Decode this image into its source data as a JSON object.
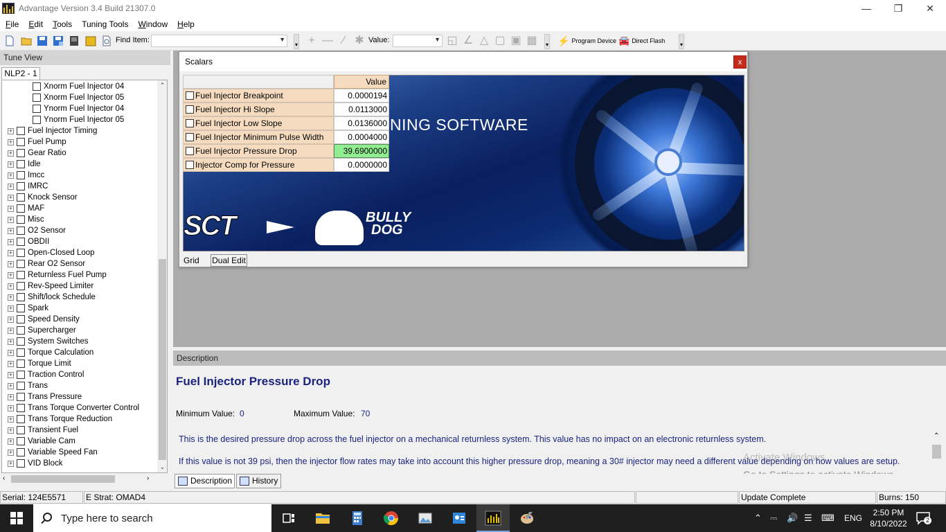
{
  "window": {
    "title": "Advantage Version 3.4 Build 21307.0"
  },
  "menu": [
    {
      "label": "File",
      "ul": "F",
      "rest": "ile"
    },
    {
      "label": "Edit",
      "ul": "E",
      "rest": "dit"
    },
    {
      "label": "Tools",
      "ul": "T",
      "rest": "ools"
    },
    {
      "label": "Tuning Tools",
      "ul": "Tu",
      "rest": "ning Tools"
    },
    {
      "label": "Window",
      "ul": "W",
      "rest": "indow"
    },
    {
      "label": "Help",
      "ul": "H",
      "rest": "elp"
    }
  ],
  "toolbar": {
    "find_label": "Find Item:",
    "find_value": "",
    "value_label": "Value:",
    "value_value": "",
    "program_device": "Program Device",
    "direct_flash": "Direct Flash"
  },
  "tune_view": {
    "header": "Tune View",
    "tab": "NLP2 - 1",
    "child_items": [
      "Xnorm Fuel Injector 04",
      "Xnorm Fuel Injector 05",
      "Ynorm Fuel Injector 04",
      "Ynorm Fuel Injector 05"
    ],
    "items": [
      "Fuel Injector Timing",
      "Fuel Pump",
      "Gear Ratio",
      "Idle",
      "Imcc",
      "IMRC",
      "Knock Sensor",
      "MAF",
      "Misc",
      "O2 Sensor",
      "OBDII",
      "Open-Closed Loop",
      "Rear O2 Sensor",
      "Returnless Fuel Pump",
      "Rev-Speed Limiter",
      "Shift/lock Schedule",
      "Spark",
      "Speed Density",
      "Supercharger",
      "System Switches",
      "Torque Calculation",
      "Torque Limit",
      "Traction Control",
      "Trans",
      "Trans Pressure",
      "Trans Torque Converter Control",
      "Trans Torque Reduction",
      "Transient Fuel",
      "Variable Cam",
      "Variable Speed Fan",
      "VID Block"
    ]
  },
  "scalars": {
    "title": "Scalars",
    "close": "x",
    "value_header": "Value",
    "rows": [
      {
        "name": "Fuel Injector Breakpoint",
        "value": "0.0000194"
      },
      {
        "name": "Fuel Injector Hi Slope",
        "value": "0.0113000"
      },
      {
        "name": "Fuel Injector Low Slope",
        "value": "0.0136000"
      },
      {
        "name": "Fuel Injector Minimum Pulse Width",
        "value": "0.0004000"
      },
      {
        "name": "Fuel Injector Pressure Drop",
        "value": "39.6900000"
      },
      {
        "name": "Injector Comp for Pressure",
        "value": "0.0000000"
      }
    ],
    "banner_text": "NING SOFTWARE",
    "banner_logo_sct": "SCT",
    "banner_logo_bully": "BULLY",
    "banner_logo_dog": "DOG",
    "tab_grid": "Grid",
    "tab_dual": "Dual Edit"
  },
  "description": {
    "header": "Description",
    "title": "Fuel Injector Pressure Drop",
    "min_label": "Minimum Value:",
    "min_value": "0",
    "max_label": "Maximum Value:",
    "max_value": "70",
    "para1": "This is the desired pressure drop across the fuel injector on a mechanical returnless system. This value has no impact on an electronic returnless system.",
    "para2": "If this value is not 39 psi, then the injector flow rates may take into account this higher pressure drop, meaning a 30# injector may need a different value depending on how values are setup.",
    "tab_description": "Description",
    "tab_history": "History",
    "watermark1": "Activate Windows",
    "watermark2": "Go to Settings to activate Windows."
  },
  "status": {
    "serial": "Serial: 124E5571",
    "strat": "E Strat: OMAD4",
    "update": "Update Complete",
    "burns": "Burns: 150"
  },
  "taskbar": {
    "search_placeholder": "Type here to search",
    "lang": "ENG",
    "time": "2:50 PM",
    "date": "8/10/2022",
    "notification_count": "2"
  }
}
